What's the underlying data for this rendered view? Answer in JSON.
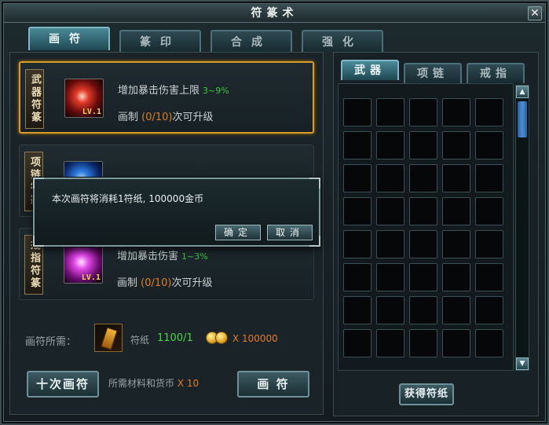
{
  "window": {
    "title": "符篆术",
    "close_glyph": "✕"
  },
  "main_tabs": [
    {
      "label": "画符",
      "active": true
    },
    {
      "label": "篆印",
      "active": false
    },
    {
      "label": "合成",
      "active": false
    },
    {
      "label": "强化",
      "active": false
    }
  ],
  "rune_cards": [
    {
      "tag": "武器符篆",
      "icon": "weapon-rune-icon",
      "level": "LV.1",
      "effect": "增加暴击伤害上限",
      "range": "3~9%",
      "progress_prefix": "画制",
      "progress": "(0/10)",
      "progress_suffix": "次可升级",
      "selected": true
    },
    {
      "tag": "项链符篆",
      "icon": "necklace-rune-icon",
      "level": "",
      "effect": "",
      "range": "",
      "progress_prefix": "",
      "progress": "",
      "progress_suffix": "",
      "selected": false
    },
    {
      "tag": "戒指符篆",
      "icon": "ring-rune-icon",
      "level": "LV.1",
      "effect": "增加暴击伤害",
      "range": "1~3%",
      "progress_prefix": "画制",
      "progress": "(0/10)",
      "progress_suffix": "次可升级",
      "selected": false
    }
  ],
  "requirements": {
    "label": "画符所需：",
    "paper_label": "符纸",
    "paper_count": "1100/1",
    "gold_x": "X",
    "gold_amount": "100000"
  },
  "buttons": {
    "ten_draw": "十次画符",
    "draw": "画 符",
    "get_paper": "获得符纸"
  },
  "materials": {
    "text": "所需材料和货币",
    "multiplier": "X 10"
  },
  "sub_tabs": [
    {
      "label": "武器",
      "active": true
    },
    {
      "label": "项链",
      "active": false
    },
    {
      "label": "戒指",
      "active": false
    }
  ],
  "inventory": {
    "columns": 5,
    "rows": 8
  },
  "scroll": {
    "up": "▲",
    "down": "▼"
  },
  "dialog": {
    "message": "本次画符将消耗1符纸, 100000金币",
    "confirm": "确定",
    "cancel": "取消"
  }
}
